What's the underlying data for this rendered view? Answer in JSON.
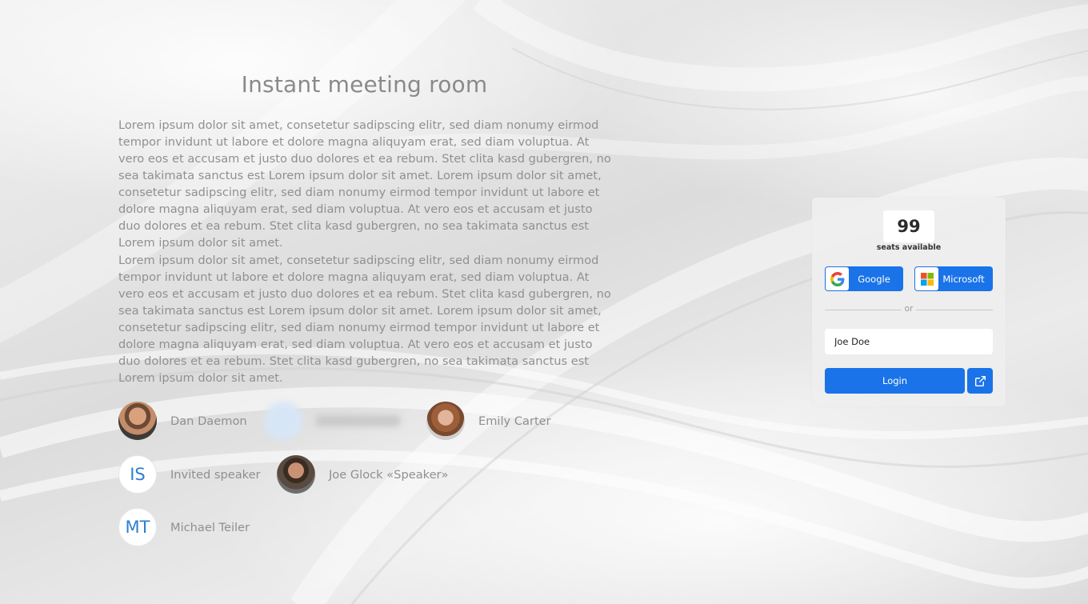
{
  "page": {
    "title": "Instant meeting room",
    "paragraphs": [
      "Lorem ipsum dolor sit amet, consetetur sadipscing elitr, sed diam nonumy eirmod tempor invidunt ut labore et dolore magna aliquyam erat, sed diam voluptua. At vero eos et accusam et justo duo dolores et ea rebum. Stet clita kasd gubergren, no sea takimata sanctus est Lorem ipsum dolor sit amet. Lorem ipsum dolor sit amet, consetetur sadipscing elitr, sed diam nonumy eirmod tempor invidunt ut labore et dolore magna aliquyam erat, sed diam voluptua. At vero eos et accusam et justo duo dolores et ea rebum. Stet clita kasd gubergren, no sea takimata sanctus est Lorem ipsum dolor sit amet.",
      "Lorem ipsum dolor sit amet, consetetur sadipscing elitr, sed diam nonumy eirmod tempor invidunt ut labore et dolore magna aliquyam erat, sed diam voluptua. At vero eos et accusam et justo duo dolores et ea rebum. Stet clita kasd gubergren, no sea takimata sanctus est Lorem ipsum dolor sit amet. Lorem ipsum dolor sit amet, consetetur sadipscing elitr, sed diam nonumy eirmod tempor invidunt ut labore et dolore magna aliquyam erat, sed diam voluptua. At vero eos et accusam et justo duo dolores et ea rebum. Stet clita kasd gubergren, no sea takimata sanctus est Lorem ipsum dolor sit amet."
    ]
  },
  "speakers": [
    {
      "name": "Dan Daemon",
      "avatar": "photo"
    },
    {
      "name": "Emily Carter",
      "avatar": "photo"
    },
    {
      "name": "Invited speaker",
      "avatar": "initials",
      "initials": "IS"
    },
    {
      "name": "Joe Glock «Speaker»",
      "avatar": "photo"
    },
    {
      "name": "Michael Teiler",
      "avatar": "initials",
      "initials": "MT"
    }
  ],
  "login_card": {
    "seats_count": "99",
    "seats_label": "seats available",
    "google_label": "Google",
    "microsoft_label": "Microsoft",
    "divider_text": "or",
    "name_value": "Joe Doe",
    "login_label": "Login",
    "external_icon": "external-link-icon"
  },
  "colors": {
    "accent": "#1a73e8",
    "initials_text": "#2d7fd0",
    "body_text": "#909090"
  }
}
